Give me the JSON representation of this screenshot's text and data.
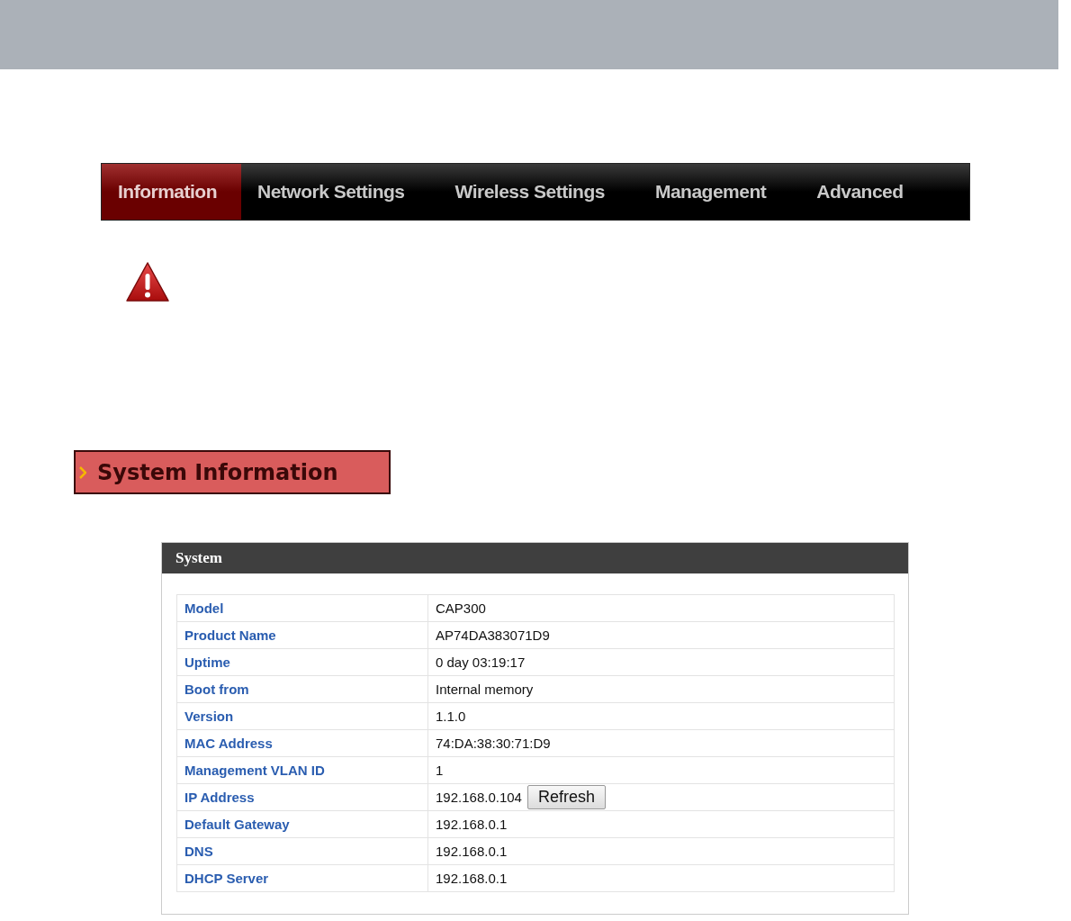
{
  "nav": {
    "tabs": [
      {
        "label": "Information",
        "selected": true
      },
      {
        "label": "Network Settings",
        "selected": false
      },
      {
        "label": "Wireless Settings",
        "selected": false
      },
      {
        "label": "Management",
        "selected": false
      },
      {
        "label": "Advanced",
        "selected": false
      }
    ]
  },
  "section": {
    "title": "System Information"
  },
  "panel": {
    "title": "System",
    "rows": [
      {
        "label": "Model",
        "value": "CAP300"
      },
      {
        "label": "Product Name",
        "value": "AP74DA383071D9"
      },
      {
        "label": "Uptime",
        "value": "0 day 03:19:17"
      },
      {
        "label": "Boot from",
        "value": "Internal memory"
      },
      {
        "label": "Version",
        "value": "1.1.0"
      },
      {
        "label": "MAC Address",
        "value": "74:DA:38:30:71:D9"
      },
      {
        "label": "Management VLAN ID",
        "value": "1"
      },
      {
        "label": "IP Address",
        "value": "192.168.0.104",
        "button": "Refresh"
      },
      {
        "label": "Default Gateway",
        "value": "192.168.0.1"
      },
      {
        "label": "DNS",
        "value": "192.168.0.1"
      },
      {
        "label": "DHCP Server",
        "value": "192.168.0.1"
      }
    ]
  }
}
